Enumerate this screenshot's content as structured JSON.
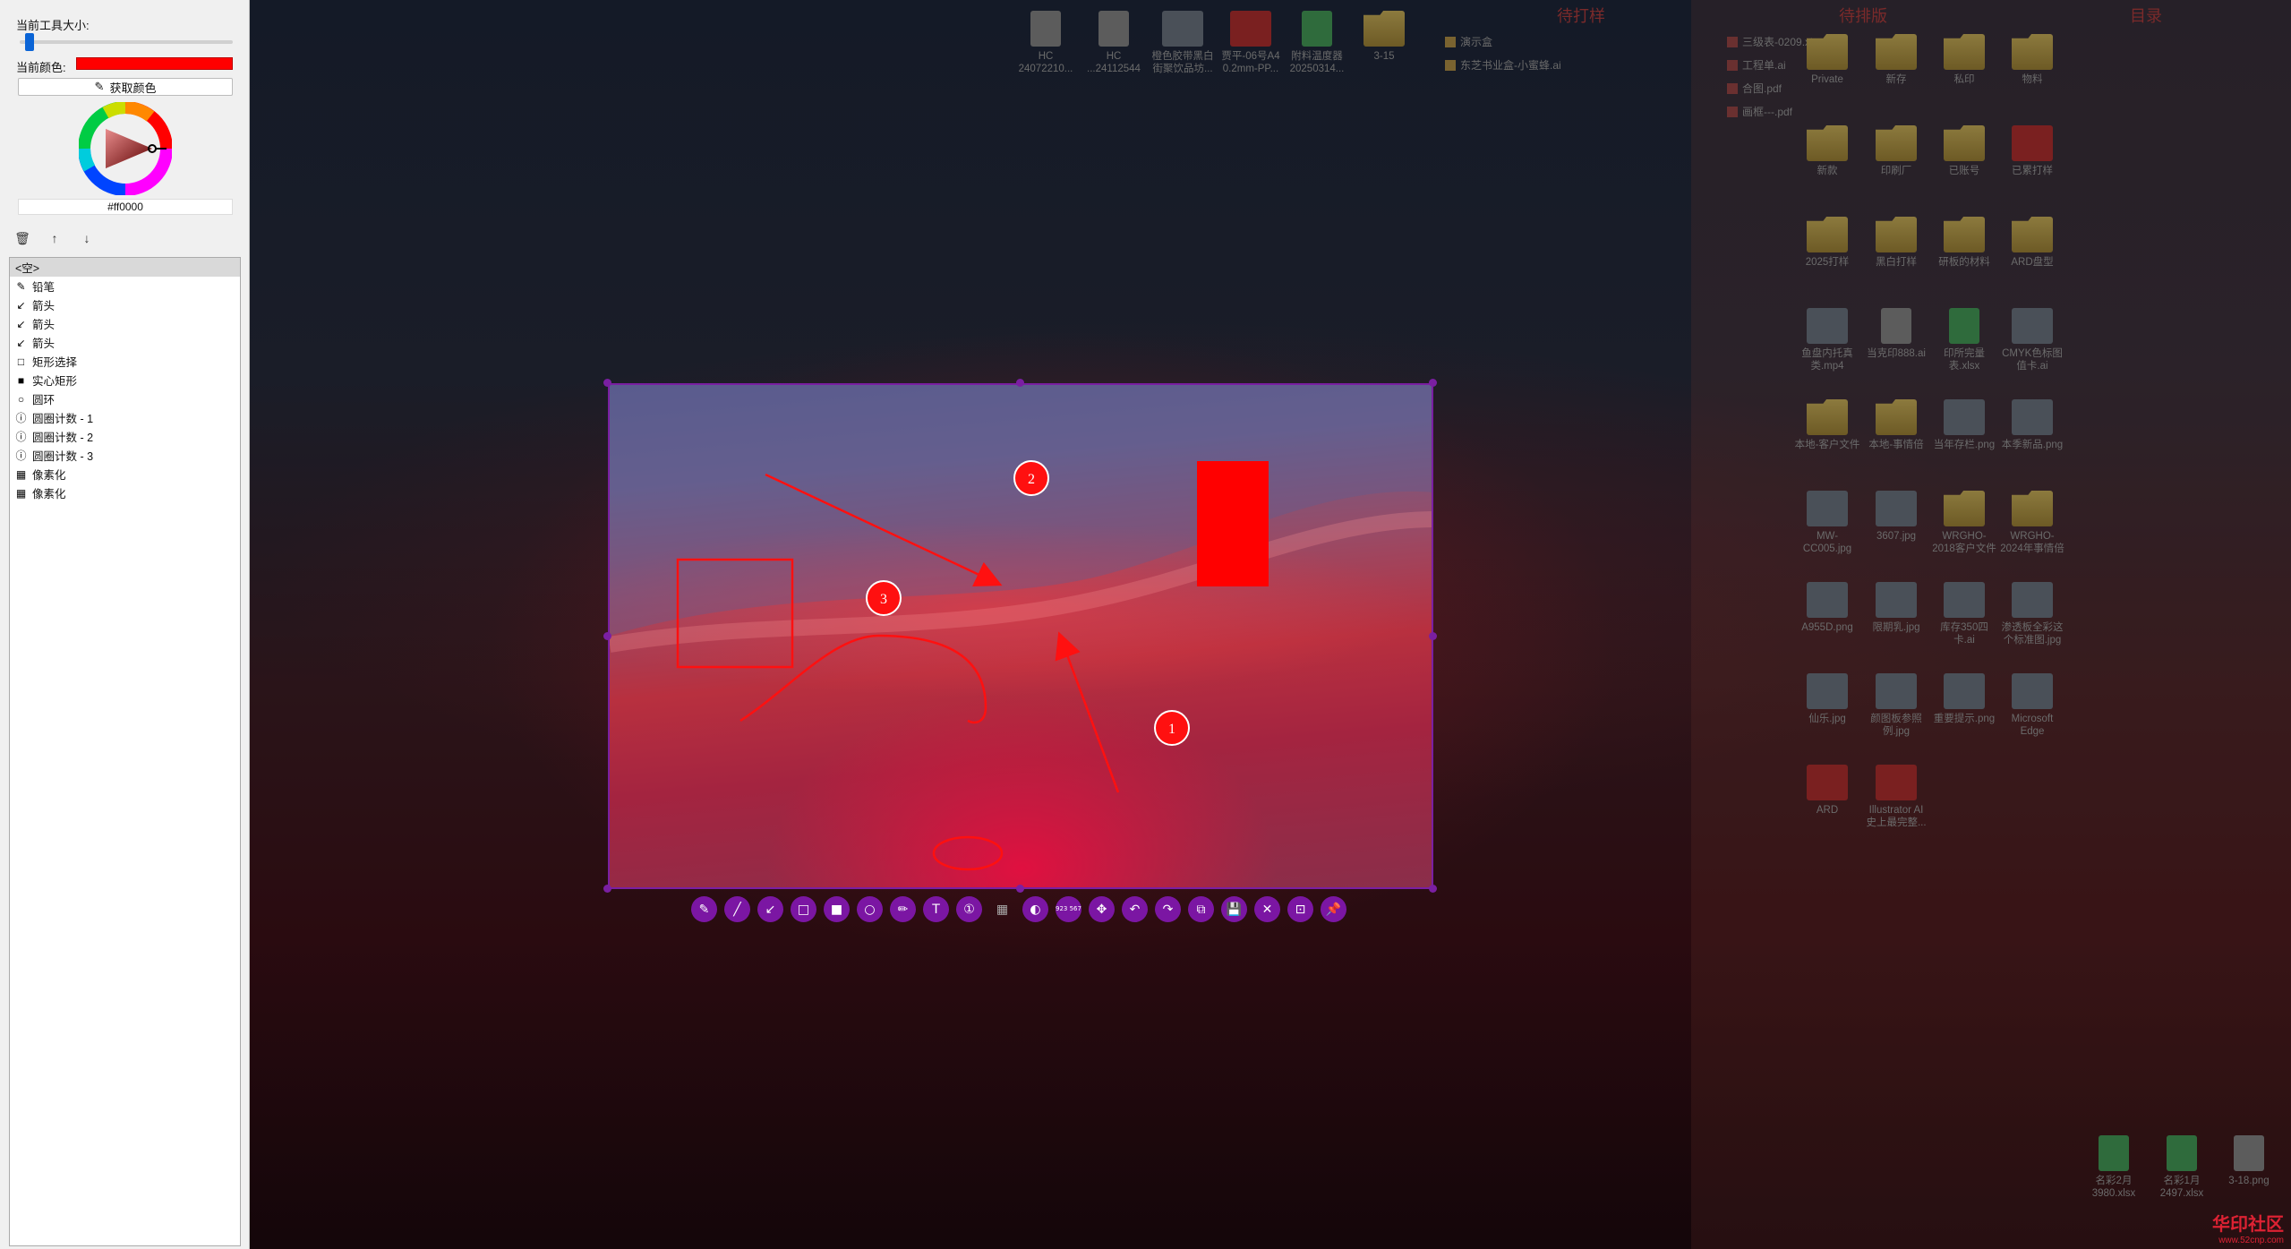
{
  "panel": {
    "size_label": "当前工具大小:",
    "color_label": "当前颜色:",
    "current_color": "#ff0000",
    "pick_color_label": "获取颜色",
    "hex_value": "#ff0000",
    "delete_icon": "trash-icon",
    "up_icon": "arrow-up-icon",
    "down_icon": "arrow-down-icon",
    "layers": [
      {
        "label": "<空>",
        "icon": "none",
        "selected": true
      },
      {
        "label": "铅笔",
        "icon": "pencil-icon"
      },
      {
        "label": "箭头",
        "icon": "arrow-icon"
      },
      {
        "label": "箭头",
        "icon": "arrow-icon"
      },
      {
        "label": "箭头",
        "icon": "arrow-icon"
      },
      {
        "label": "矩形选择",
        "icon": "rect-outline-icon"
      },
      {
        "label": "实心矩形",
        "icon": "rect-filled-icon"
      },
      {
        "label": "圆环",
        "icon": "circle-icon"
      },
      {
        "label": "圆圈计数 - 1",
        "icon": "counter-icon"
      },
      {
        "label": "圆圈计数 - 2",
        "icon": "counter-icon"
      },
      {
        "label": "圆圈计数 - 3",
        "icon": "counter-icon"
      },
      {
        "label": "像素化",
        "icon": "mosaic-icon"
      },
      {
        "label": "像素化",
        "icon": "mosaic-icon"
      }
    ]
  },
  "desktop": {
    "headers": [
      "待打样",
      "待排版",
      "目录"
    ],
    "top_icons": [
      {
        "label": "HC 24072210...",
        "kind": "doc"
      },
      {
        "label": "HC ...24112544",
        "kind": "doc"
      },
      {
        "label": "橙色胶带黑白 街聚饮品坊...",
        "kind": "thumb"
      },
      {
        "label": "贾平-06号A4 0.2mm-PP...",
        "kind": "red"
      },
      {
        "label": "附料温度器 20250314...",
        "kind": "xl"
      },
      {
        "label": "3-15",
        "kind": "folder"
      }
    ],
    "mid_list": [
      "演示盒",
      "东芝书业盒-小蜜蜂.ai"
    ],
    "mid_list2": [
      "三级表-0209.xlsx",
      "工程单.ai",
      "合图.pdf",
      "画框---.pdf"
    ],
    "right_icons": [
      "Private",
      "新存",
      "私印",
      "物料",
      "新款",
      "印刷厂",
      "已账号",
      "已累打样",
      "2025打样",
      "黑白打样",
      "研板的材料",
      "ARD盘型",
      "鱼盘内托真类.mp4",
      "当克印888.ai",
      "印所完量表.xlsx",
      "CMYK色标图值卡.ai",
      "本地-客户文件",
      "本地-事情倍",
      "当年存栏.png",
      "本季新品.png",
      "MW-CC005.jpg",
      "3607.jpg",
      "WRGHO-2018客户文件",
      "WRGHO-2024年事情倍",
      "A955D.png",
      "限期乳.jpg",
      "库存350四卡.ai",
      "渗透板全彩这个标准图.jpg",
      "仙乐.jpg",
      "颜图板参照例.jpg",
      "重要提示.png",
      "Microsoft Edge",
      "ARD",
      "Illustrator AI 史上最完整..."
    ],
    "bottom_icons": [
      "名彩2月3980.xlsx",
      "名彩1月2497.xlsx",
      "3-18.png"
    ],
    "watermark": "华印社区",
    "watermark_sub": "www.52cnp.com"
  },
  "canvas": {
    "counters": [
      "1",
      "2",
      "3"
    ]
  },
  "toolbar": {
    "tools": [
      {
        "name": "pencil-tool",
        "glyph": "✎"
      },
      {
        "name": "line-tool",
        "glyph": "╱"
      },
      {
        "name": "arrow-tool",
        "glyph": "↙"
      },
      {
        "name": "rect-tool",
        "glyph": "□"
      },
      {
        "name": "filled-rect-tool",
        "glyph": "■"
      },
      {
        "name": "circle-tool",
        "glyph": "○"
      },
      {
        "name": "marker-tool",
        "glyph": "✏"
      },
      {
        "name": "text-tool",
        "glyph": "T"
      },
      {
        "name": "counter-tool",
        "glyph": "①"
      },
      {
        "name": "pixelate-tool",
        "glyph": "▦"
      },
      {
        "name": "invert-tool",
        "glyph": "◐"
      },
      {
        "name": "size-tool",
        "glyph": "923 567"
      },
      {
        "name": "move-tool",
        "glyph": "✥"
      },
      {
        "name": "undo-tool",
        "glyph": "↶"
      },
      {
        "name": "redo-tool",
        "glyph": "↷"
      },
      {
        "name": "copy-tool",
        "glyph": "⧉"
      },
      {
        "name": "save-tool",
        "glyph": "💾"
      },
      {
        "name": "exit-tool",
        "glyph": "✕"
      },
      {
        "name": "app-launch-tool",
        "glyph": "⊡"
      },
      {
        "name": "pin-tool",
        "glyph": "📌"
      }
    ]
  }
}
